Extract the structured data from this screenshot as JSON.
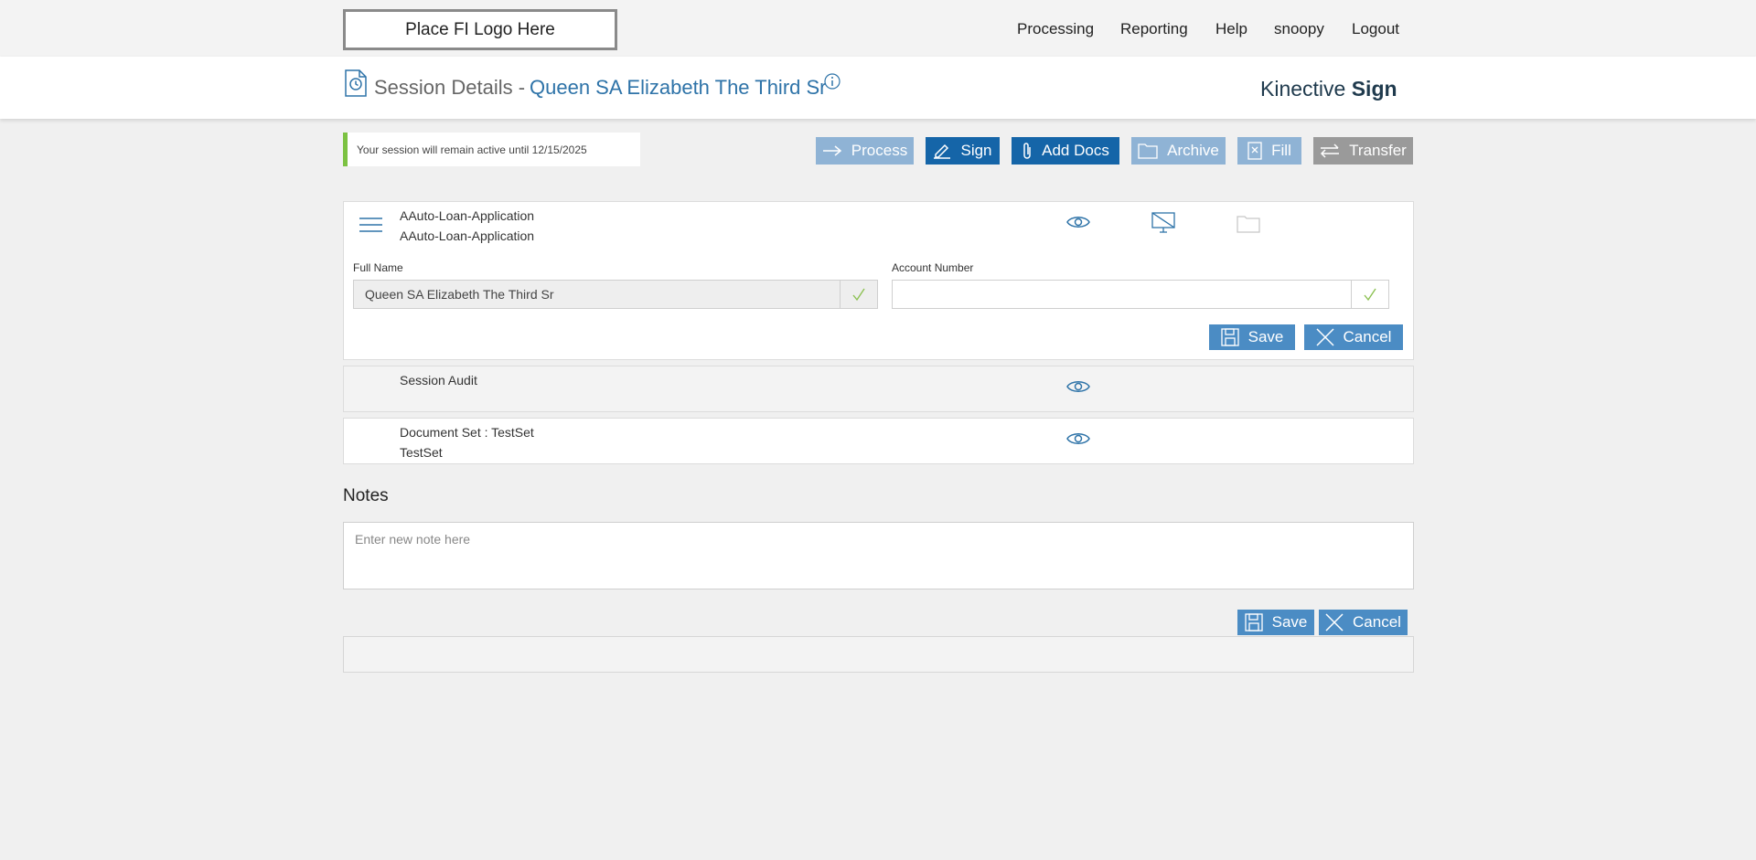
{
  "topbar": {
    "logo_text": "Place FI Logo Here",
    "nav": [
      "Processing",
      "Reporting",
      "Help",
      "snoopy",
      "Logout"
    ]
  },
  "header": {
    "title_prefix": "Session Details -",
    "session_name": "Queen SA Elizabeth The Third Sr",
    "brand_regular": "Kinective",
    "brand_bold": "Sign"
  },
  "notice": "Your session will remain active until 12/15/2025",
  "actions": {
    "process": "Process",
    "sign": "Sign",
    "add_docs": "Add Docs",
    "archive": "Archive",
    "fill": "Fill",
    "transfer": "Transfer"
  },
  "documents": [
    {
      "line1": "AAuto-Loan-Application",
      "line2": "AAuto-Loan-Application",
      "fields": [
        {
          "label": "Full Name",
          "value": "Queen SA Elizabeth The Third Sr"
        },
        {
          "label": "Account Number",
          "value": ""
        }
      ],
      "save_label": "Save",
      "cancel_label": "Cancel"
    },
    {
      "line1": "Session Audit"
    },
    {
      "line1": "Document Set : TestSet",
      "line2": "TestSet"
    }
  ],
  "notes": {
    "title": "Notes",
    "placeholder": "Enter new note here",
    "save_label": "Save",
    "cancel_label": "Cancel"
  },
  "colors": {
    "accent_blue": "#2e73a8",
    "dark_button": "#1565a8",
    "light_button": "#8fb3d5",
    "grey_button": "#9a9a9a",
    "notice_bar": "#7cc242",
    "check_green": "#8cc152"
  }
}
